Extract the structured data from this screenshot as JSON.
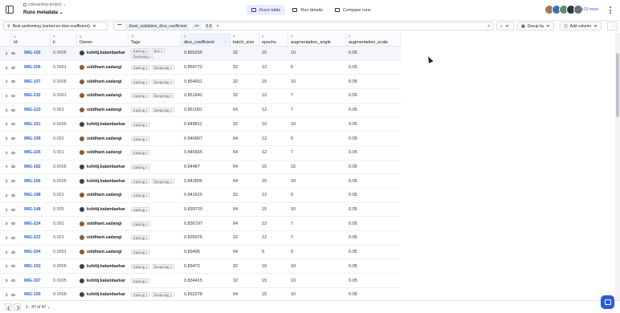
{
  "header": {
    "project_name": "onboarding-project",
    "page_title": "Runs metadata",
    "tabs": [
      {
        "label": "Runs table",
        "active": true
      },
      {
        "label": "Run details",
        "active": false
      },
      {
        "label": "Compare runs",
        "active": false
      }
    ],
    "more_users": "+13 more",
    "avatar_colors": [
      "#a0784b",
      "#3b6fb6",
      "#5a8f6f",
      "#2d3440",
      "#6a6f7a"
    ]
  },
  "toolbar": {
    "view_label": "Best performing (sorted-on-dice-coefficient)",
    "filter_field": "../best_validation_dice_coefficient",
    "filter_op": ">=",
    "filter_value": "0.8",
    "clear_icon": "x",
    "group_by_label": "Group by",
    "add_column_label": "Add column"
  },
  "columns": [
    {
      "type": "a",
      "name": "Id"
    },
    {
      "type": "#",
      "name": "lr"
    },
    {
      "type": "a",
      "name": "Owner"
    },
    {
      "type": "☰",
      "name": "Tags"
    },
    {
      "type": "#",
      "name": "dice_coefficient"
    },
    {
      "type": "#",
      "name": "batch_size"
    },
    {
      "type": "#",
      "name": "epochs"
    },
    {
      "type": "#",
      "name": "augmentation_angle"
    },
    {
      "type": "#",
      "name": "augmentation_scale"
    }
  ],
  "rows": [
    {
      "id": "IMG-155",
      "lr": "0.0005",
      "owner": "kshitij.kalambarkar",
      "tags": [
        "training",
        "bee",
        "finetuning"
      ],
      "dice": "0.855255",
      "batch": "32",
      "epochs": "15",
      "angle": "10",
      "scale": "0.05"
    },
    {
      "id": "IMG-206",
      "lr": "0.0001",
      "owner": "siddhant.sadangi",
      "tags": [
        "training",
        "finetuning"
      ],
      "dice": "0.854772",
      "batch": "32",
      "epochs": "12",
      "angle": "5",
      "scale": "0.05"
    },
    {
      "id": "IMG-157",
      "lr": "0.0005",
      "owner": "siddhant.sadangi",
      "tags": [
        "training",
        "finetuning"
      ],
      "dice": "0.854651",
      "batch": "32",
      "epochs": "15",
      "angle": "10",
      "scale": "0.05"
    },
    {
      "id": "IMG-232",
      "lr": "0.0001",
      "owner": "siddhant.sadangi",
      "tags": [
        "training",
        "finetuning"
      ],
      "dice": "0.851841",
      "batch": "32",
      "epochs": "12",
      "angle": "7",
      "scale": "0.05"
    },
    {
      "id": "IMG-223",
      "lr": "0.001",
      "owner": "siddhant.sadangi",
      "tags": [
        "training",
        "finetuning"
      ],
      "dice": "0.851001",
      "batch": "64",
      "epochs": "12",
      "angle": "7",
      "scale": "0.05"
    },
    {
      "id": "IMG-151",
      "lr": "0.0005",
      "owner": "kshitij.kalambarkar",
      "tags": [
        "training"
      ],
      "dice": "0.848811",
      "batch": "32",
      "epochs": "10",
      "angle": "10",
      "scale": "0.05"
    },
    {
      "id": "IMG-199",
      "lr": "0.001",
      "owner": "siddhant.sadangi",
      "tags": [
        "training"
      ],
      "dice": "0.846907",
      "batch": "64",
      "epochs": "12",
      "angle": "5",
      "scale": "0.05"
    },
    {
      "id": "IMG-225",
      "lr": "0.001",
      "owner": "siddhant.sadangi",
      "tags": [
        "training"
      ],
      "dice": "0.845665",
      "batch": "64",
      "epochs": "12",
      "angle": "7",
      "scale": "0.05"
    },
    {
      "id": "IMG-182",
      "lr": "0.0005",
      "owner": "kshitij.kalambarkar",
      "tags": [
        "training"
      ],
      "dice": "0.84487",
      "batch": "64",
      "epochs": "15",
      "angle": "15",
      "scale": "0.05"
    },
    {
      "id": "IMG-156",
      "lr": "0.0005",
      "owner": "kshitij.kalambarkar",
      "tags": [
        "training",
        "finetuning"
      ],
      "dice": "0.842805",
      "batch": "64",
      "epochs": "15",
      "angle": "10",
      "scale": "0.05"
    },
    {
      "id": "IMG-198",
      "lr": "0.001",
      "owner": "siddhant.sadangi",
      "tags": [
        "training"
      ],
      "dice": "0.841616",
      "batch": "32",
      "epochs": "12",
      "angle": "5",
      "scale": "0.05"
    },
    {
      "id": "IMG-148",
      "lr": "0.005",
      "owner": "kshitij.kalambarkar",
      "tags": [
        "training"
      ],
      "dice": "0.839729",
      "batch": "64",
      "epochs": "15",
      "angle": "10",
      "scale": "0.05"
    },
    {
      "id": "IMG-224",
      "lr": "0.001",
      "owner": "siddhant.sadangi",
      "tags": [
        "training"
      ],
      "dice": "0.836797",
      "batch": "64",
      "epochs": "12",
      "angle": "7",
      "scale": "0.05"
    },
    {
      "id": "IMG-222",
      "lr": "0.001",
      "owner": "siddhant.sadangi",
      "tags": [
        "training"
      ],
      "dice": "0.835076",
      "batch": "32",
      "epochs": "12",
      "angle": "7",
      "scale": "0.05"
    },
    {
      "id": "IMG-204",
      "lr": "0.0001",
      "owner": "siddhant.sadangi",
      "tags": [
        "training"
      ],
      "dice": "0.83495",
      "batch": "64",
      "epochs": "9",
      "angle": "5",
      "scale": "0.05"
    },
    {
      "id": "IMG-153",
      "lr": "0.0005",
      "owner": "kshitij.kalambarkar",
      "tags": [
        "training",
        "finetuning"
      ],
      "dice": "0.83472",
      "batch": "32",
      "epochs": "10",
      "angle": "10",
      "scale": "0.05"
    },
    {
      "id": "IMG-157",
      "lr": "0.0005",
      "owner": "kshitij.kalambarkar",
      "tags": [
        "training"
      ],
      "dice": "0.834415",
      "batch": "32",
      "epochs": "15",
      "angle": "10",
      "scale": "0.05"
    },
    {
      "id": "IMG-150",
      "lr": "0.0005",
      "owner": "kshitij.kalambarkar",
      "tags": [
        "training",
        "finetuning"
      ],
      "dice": "0.832278",
      "batch": "64",
      "epochs": "15",
      "angle": "10",
      "scale": "0.05"
    }
  ],
  "owner_colors": {
    "kshitij.kalambarkar": "#3a3f4a",
    "siddhant.sadangi": "#8a5a3a"
  },
  "footer": {
    "pagination": "1 - 47 of 47"
  }
}
